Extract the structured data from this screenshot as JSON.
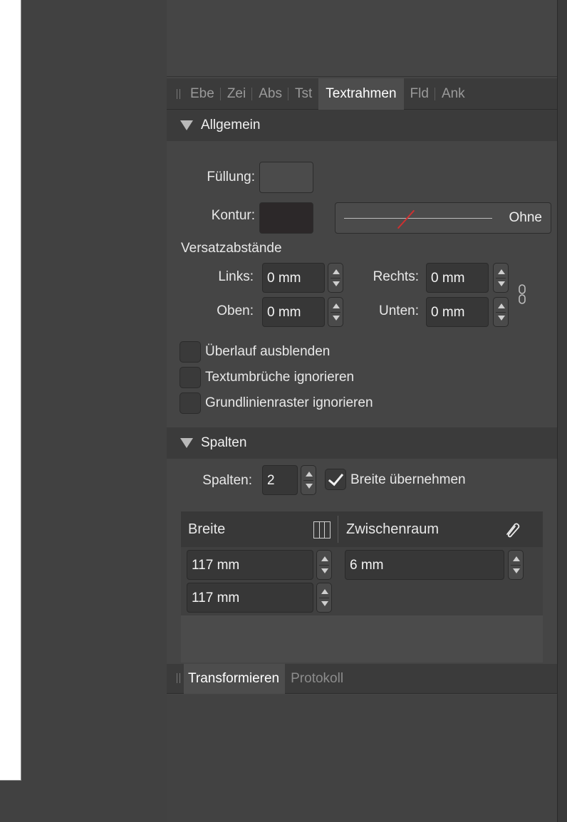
{
  "tabs": [
    "Ebe",
    "Zei",
    "Abs",
    "Tst",
    "Textrahmen",
    "Fld",
    "Ank"
  ],
  "active_tab_index": 4,
  "allgemein": {
    "header": "Allgemein",
    "fill_label": "Füllung:",
    "stroke_label": "Kontur:",
    "stroke_style": "Ohne",
    "fill_color": "#4b4b4b",
    "stroke_color": "#2c2829",
    "insets_heading": "Versatzabstände",
    "left_label": "Links:",
    "left_value": "0 mm",
    "right_label": "Rechts:",
    "right_value": "0 mm",
    "top_label": "Oben:",
    "top_value": "0 mm",
    "bottom_label": "Unten:",
    "bottom_value": "0 mm",
    "checkboxes": [
      {
        "label": "Überlauf ausblenden",
        "checked": false
      },
      {
        "label": "Textumbrüche ignorieren",
        "checked": false
      },
      {
        "label": "Grundlinienraster ignorieren",
        "checked": false
      }
    ]
  },
  "spalten": {
    "header": "Spalten",
    "count_label": "Spalten:",
    "count_value": "2",
    "equal_width_label": "Breite übernehmen",
    "equal_width_checked": true,
    "col_width_header": "Breite",
    "gutter_header": "Zwischenraum",
    "rows": [
      {
        "width": "117 mm",
        "gutter": "6 mm"
      },
      {
        "width": "117 mm"
      }
    ]
  },
  "bottom_tabs": [
    "Transformieren",
    "Protokoll"
  ],
  "bottom_active_tab_index": 0
}
